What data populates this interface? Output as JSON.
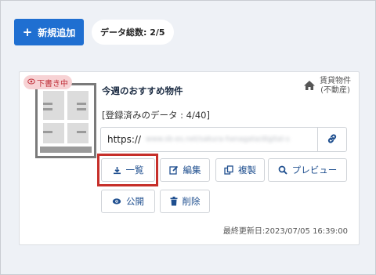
{
  "toolbar": {
    "add_label": "新規追加",
    "add_icon": "plus-icon",
    "count_label": "データ総数: 2/5"
  },
  "card": {
    "status_badge": "下書き中",
    "title": "今週のおすすめ物件",
    "category_line1": "賃貸物件",
    "category_line2": "(不動産)",
    "data_count": "[登録済みのデータ : 4/40]",
    "url_prefix": "https://",
    "url_blurred": "www.sb-es.net/sakura-hanagata/digital-s",
    "buttons": {
      "list": "一覧",
      "edit": "編集",
      "duplicate": "複製",
      "preview": "プレビュー",
      "publish": "公開",
      "delete": "削除"
    },
    "last_updated": "最終更新日:2023/07/05 16:39:00"
  },
  "colors": {
    "primary": "#1f6fd1",
    "text_blue": "#1f4f8f",
    "highlight": "#c62f2a",
    "badge_bg": "#f7d2d4",
    "badge_text": "#c0303a",
    "page_bg": "#eef1f6"
  }
}
